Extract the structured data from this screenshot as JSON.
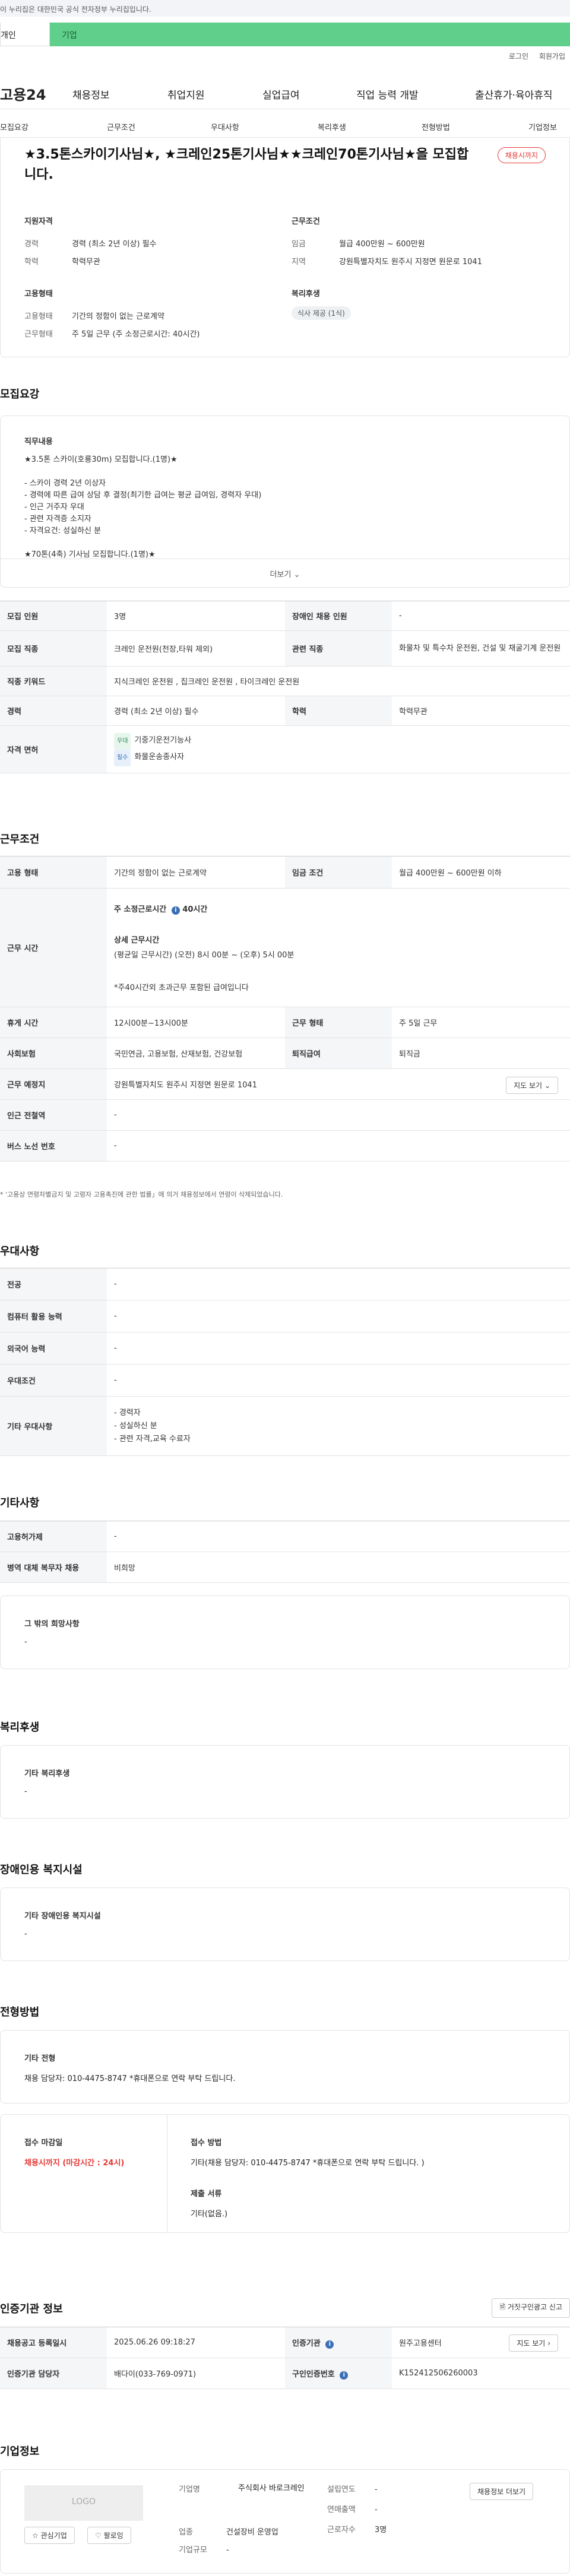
{
  "gov_banner": "이 누리집은 대한민국 공식 전자정부 누리집입니다.",
  "top_tabs": [
    "개인",
    "기업"
  ],
  "util": [
    "로그인",
    "회원가입"
  ],
  "gnb": {
    "logo": "고용24",
    "menu": [
      "채용정보",
      "취업지원",
      "실업급여",
      "직업 능력 개발",
      "출산휴가·육아휴직"
    ]
  },
  "lnb": [
    "모집요강",
    "근무조건",
    "우대사항",
    "복리후생",
    "전형방법",
    "기업정보"
  ],
  "summary": {
    "title": "★3.5톤스카이기사님★, ★크레인25톤기사님★★크레인70톤기사님★을 모집합니다.",
    "status": "채용시까지",
    "qual_h": "지원자격",
    "career_k": "경력",
    "career_v": "경력 (최소 2년 이상) 필수",
    "edu_k": "학력",
    "edu_v": "학력무관",
    "emp_h": "고용형태",
    "emp_k": "고용형태",
    "emp_v": "기간의 정함이 없는 근로계약",
    "work_k": "근무형태",
    "work_v": "주 5일 근무 (주 소정근로시간: 40시간)",
    "cond_h": "근무조건",
    "wage_k": "임금",
    "wage_v": "월급 400만원 ~ 600만원",
    "area_k": "지역",
    "area_v": "강원특별자치도 원주시 지정면 원문로 1041",
    "welfare_h": "복리후생",
    "welfare_v": "식사 제공 (1식)"
  },
  "recruit": {
    "heading": "모집요강",
    "desc_h": "직무내용",
    "desc_lines": [
      "★3.5톤 스카이(호룡30m) 모집합니다.(1명)★",
      "",
      "- 스카이 경력 2년 이상자",
      "- 경력에 따른 급여 상담 후 결정(최기한 급여는 평균 급여임, 경력자 우대)",
      "- 인근 거주자 우대",
      "- 관련 자격증 소지자",
      "- 자격요건: 성실하신 분",
      "",
      "★70톤(4축) 기사님 모집합니다.(1명)★"
    ],
    "more": "더보기",
    "rows": [
      {
        "k1": "모집 인원",
        "v1": "3명",
        "k2": "장애인 채용 인원",
        "v2": "-"
      },
      {
        "k1": "모집 직종",
        "v1": "크레인 운전원(천장,타워 제외)",
        "k2": "관련 직종",
        "v2": "화물차 및 특수차 운전원, 건설 및 채굴기계 운전원"
      },
      {
        "k1": "직종 키워드",
        "v1": "지식크레인 운전원 , 집크레인 운전원 , 타이크레인 운전원"
      },
      {
        "k1": "경력",
        "v1": "경력 (최소 2년 이상) 필수",
        "k2": "학력",
        "v2": "학력무관"
      }
    ],
    "license_k": "자격 면허",
    "license_tag1": "우대",
    "license_v1": "기중기운전기능사",
    "license_tag2": "필수",
    "license_v2": "화물운송종사자"
  },
  "workcond": {
    "heading": "근무조건",
    "emp_k": "고용 형태",
    "emp_v": "기간의 정함이 없는 근로계약",
    "wage_k": "임금 조건",
    "wage_v": "월급 400만원 ~ 600만원 이하",
    "time_k": "근무 시간",
    "time_l1": "주 소정근로시간",
    "time_l1b": "40시간",
    "time_l2": "상세 근무시간",
    "time_l3": "(평균일 근무시간) (오전) 8시 00분 ~ (오후) 5시 00분",
    "time_l4": "*주40시간외 초과근무 포함된 급여입니다",
    "rest_k": "휴게 시간",
    "rest_v": "12시00분~13시00분",
    "form_k": "근무 형태",
    "form_v": "주 5일 근무",
    "ins_k": "사회보험",
    "ins_v": "국민연금, 고용보험, 산재보험, 건강보험",
    "ret_k": "퇴직급여",
    "ret_v": "퇴직금",
    "place_k": "근무 예정지",
    "place_v": "강원특별자치도 원주시 지정면 원문로 1041",
    "map_btn": "지도 보기",
    "sub_k": "인근 전철역",
    "sub_v": "-",
    "bus_k": "버스 노선 번호",
    "bus_v": "-",
    "note": "* '고용상 연령차별금지 및 고령자 고용촉진에 관한 법률」에 의거 채용정보에서 연령이 삭제되었습니다."
  },
  "pref": {
    "heading": "우대사항",
    "rows": [
      {
        "k": "전공",
        "v": "-"
      },
      {
        "k": "컴퓨터 활용 능력",
        "v": "-"
      },
      {
        "k": "외국어 능력",
        "v": "-"
      },
      {
        "k": "우대조건",
        "v": "-"
      }
    ],
    "etc_k": "기타 우대사항",
    "etc_lines": [
      "- 경력자",
      "- 성실하신 분",
      "- 관련 자격,교육 수료자"
    ]
  },
  "other": {
    "heading": "기타사항",
    "rows": [
      {
        "k": "고용허가제",
        "v": "-"
      },
      {
        "k": "병역 대체 복무자 채용",
        "v": "비희망"
      }
    ],
    "wish_h": "그 밖의 희망사항",
    "wish_v": "-"
  },
  "welfare": {
    "heading": "복리후생",
    "h": "기타 복리후생",
    "v": "-"
  },
  "disab": {
    "heading": "장애인용 복지시설",
    "h": "기타 장애인용 복지시설",
    "v": "-"
  },
  "process": {
    "heading": "전형방법",
    "h": "기타 전형",
    "v": "채용 담당자: 010-4475-8747 *휴대폰으로 연락 부탁 드립니다.",
    "deadline_h": "접수 마감일",
    "deadline_v": "채용시까지 (마감시간 : 24시)",
    "method_h": "접수 방법",
    "method_v": "기타(채용 담당자: 010-4475-8747 *휴대폰으로 연락 부탁 드립니다. )",
    "docs_h": "제출 서류",
    "docs_v": "기타(없음.)"
  },
  "agency": {
    "heading": "인증기관 정보",
    "report_btn": "거짓구인광고 신고",
    "reg_k": "채용공고 등록일시",
    "reg_v": "2025.06.26 09:18:27",
    "ag_k": "인증기관",
    "ag_v": "원주고용센터",
    "map_btn": "지도 보기",
    "mgr_k": "인증기관 담당자",
    "mgr_v": "배다이(033-769-0971)",
    "no_k": "구인인증번호",
    "no_v": "K152412506260003"
  },
  "company": {
    "heading": "기업정보",
    "logo": "LOGO",
    "fav_btn": "관심기업",
    "follow_btn": "팔로잉",
    "name_k": "기업명",
    "name_v": "주식회사 바로크레인",
    "ind_k": "업종",
    "ind_v": "건설장비 운영업",
    "size_k": "기업규모",
    "size_v": "-",
    "year_k": "설립연도",
    "year_v": "-",
    "sales_k": "연매출액",
    "sales_v": "-",
    "emp_k": "근로자수",
    "emp_v": "3명",
    "more_btn": "채용정보 더보기"
  }
}
